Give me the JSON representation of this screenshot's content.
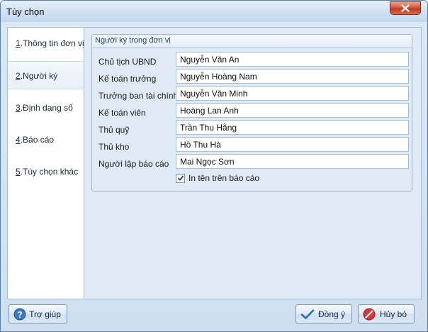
{
  "window": {
    "title": "Tùy chọn"
  },
  "nav": {
    "items": [
      {
        "num": "1",
        "label": "Thông tin đơn vị"
      },
      {
        "num": "2",
        "label": "Người ký"
      },
      {
        "num": "3",
        "label": "Định dạng số"
      },
      {
        "num": "4",
        "label": "Báo cáo"
      },
      {
        "num": "5",
        "label": "Tùy chọn khác"
      }
    ],
    "active_index": 1
  },
  "group": {
    "title": "Người ký trong đơn vị",
    "rows": [
      {
        "label": "Chủ tịch UBND",
        "value": "Nguyễn Văn An"
      },
      {
        "label": "Kế toán trưởng",
        "value": "Nguyễn Hoàng Nam"
      },
      {
        "label": "Trưởng ban tài chính",
        "value": "Nguyễn Văn Minh"
      },
      {
        "label": "Kế toán viên",
        "value": "Hoàng Lan Anh"
      },
      {
        "label": "Thủ quỹ",
        "value": "Trần Thu Hằng"
      },
      {
        "label": "Thủ kho",
        "value": "Hồ Thu Hà"
      },
      {
        "label": "Người lập báo cáo",
        "value": "Mai Ngọc Sơn"
      }
    ],
    "checkbox": {
      "label": "In tên trên báo cáo",
      "checked": true
    }
  },
  "buttons": {
    "help": "Trợ giúp",
    "ok": "Đồng ý",
    "cancel": "Hủy bỏ"
  },
  "colors": {
    "accent": "#2b6cc4",
    "close": "#c9452b",
    "cancel_icon": "#d23a3a"
  },
  "icons": {
    "close": "close-icon",
    "help": "help-icon",
    "ok": "check-icon",
    "cancel": "cancel-icon"
  }
}
